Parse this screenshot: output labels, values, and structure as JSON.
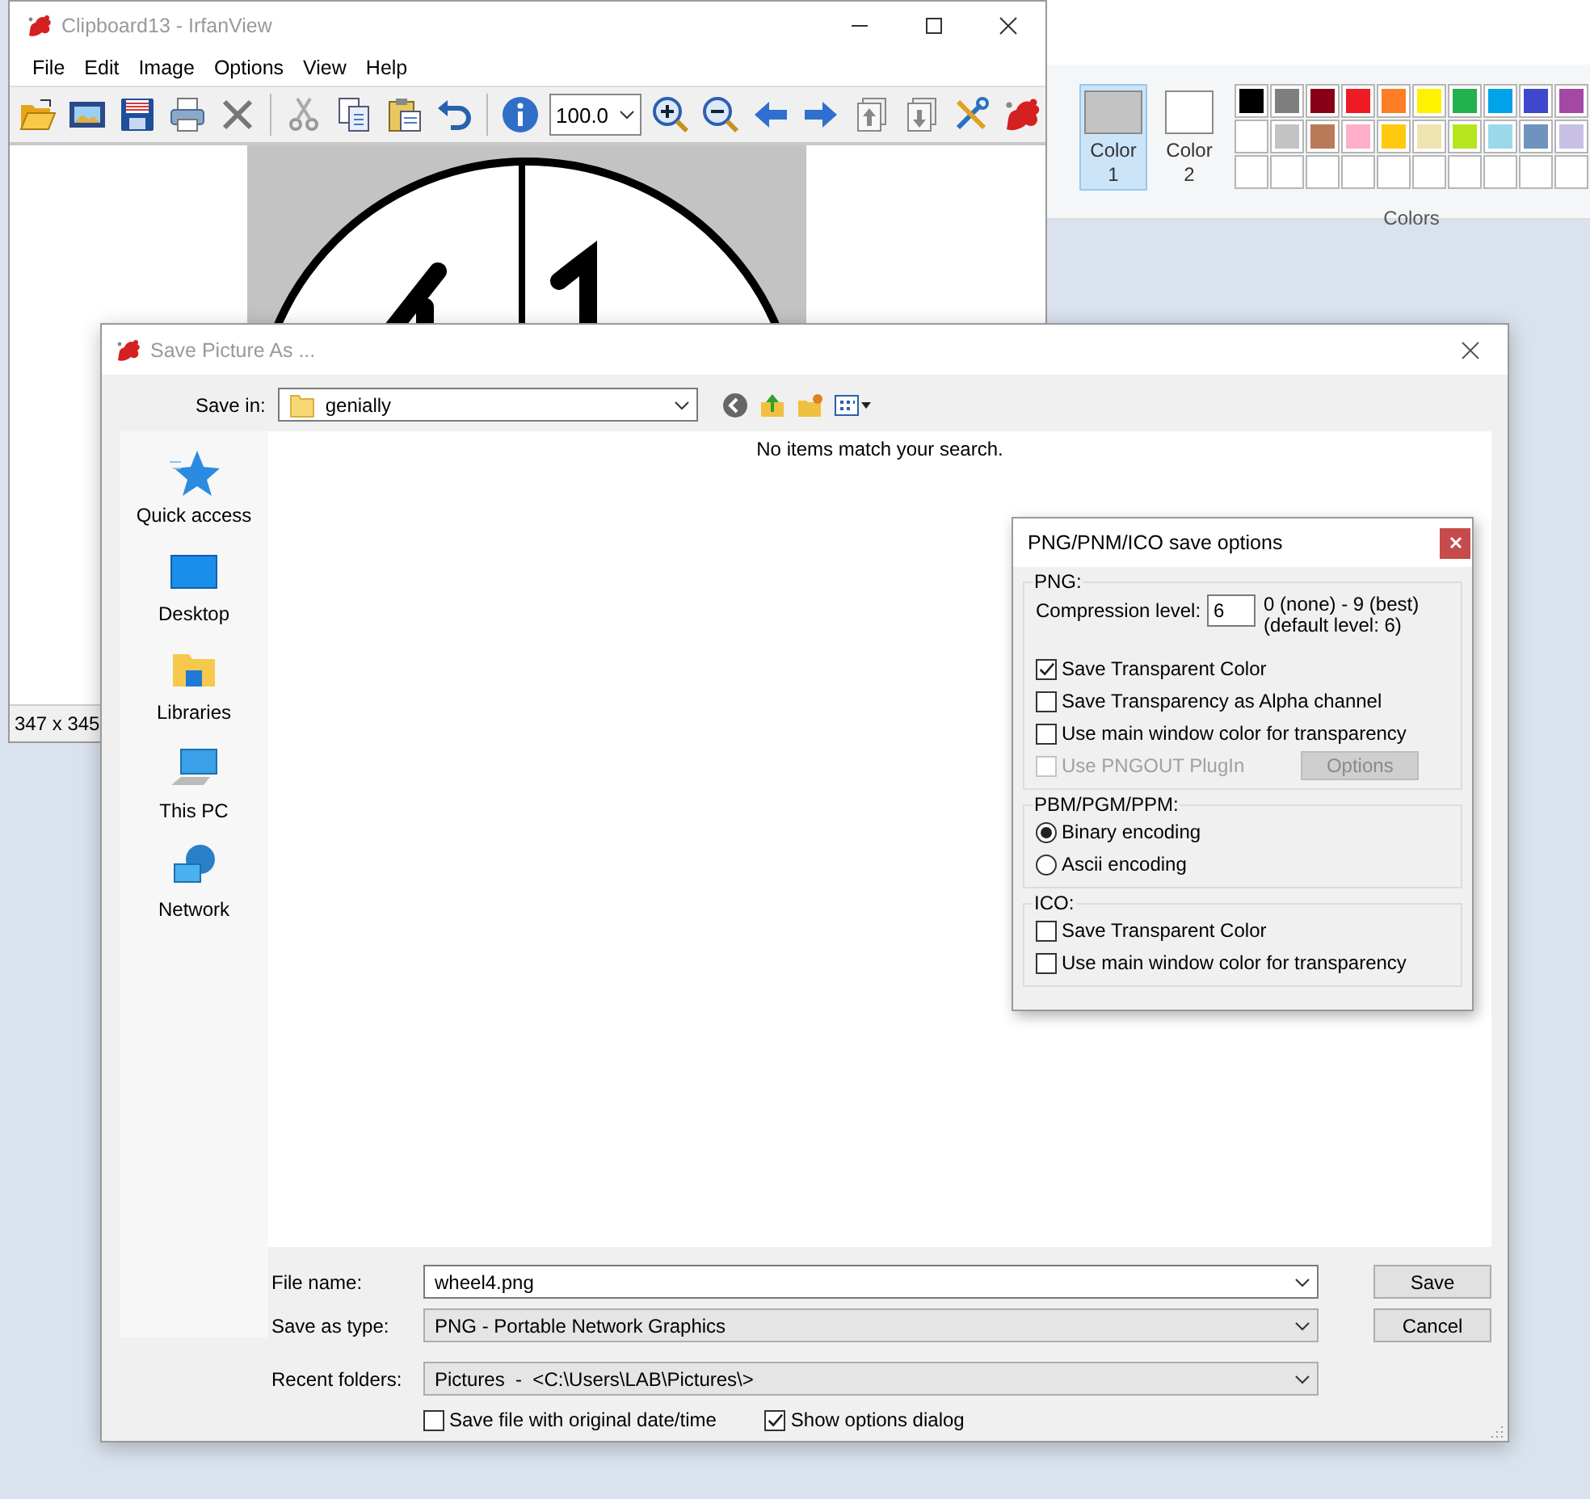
{
  "paint": {
    "color_buttons": [
      {
        "label": "Color 1",
        "color": "#c3c3c3",
        "selected": true
      },
      {
        "label": "Color 2",
        "color": "#ffffff",
        "selected": false
      }
    ],
    "palette": [
      {
        "kind": "swatch",
        "color": "#000000"
      },
      {
        "kind": "swatch",
        "color": "#7f7f7f"
      },
      {
        "kind": "swatch",
        "color": "#880015"
      },
      {
        "kind": "swatch",
        "color": "#ed1c24"
      },
      {
        "kind": "swatch",
        "color": "#ff7f27"
      },
      {
        "kind": "swatch",
        "color": "#fff200"
      },
      {
        "kind": "swatch",
        "color": "#22b14c"
      },
      {
        "kind": "swatch",
        "color": "#00a2e8"
      },
      {
        "kind": "swatch",
        "color": "#3f48cc"
      },
      {
        "kind": "swatch",
        "color": "#a349a4"
      },
      {
        "kind": "swatch",
        "color": "#ffffff"
      },
      {
        "kind": "swatch",
        "color": "#c3c3c3"
      },
      {
        "kind": "swatch",
        "color": "#b97a57"
      },
      {
        "kind": "swatch",
        "color": "#ffaec9"
      },
      {
        "kind": "swatch",
        "color": "#ffc90e"
      },
      {
        "kind": "swatch",
        "color": "#efe4b0"
      },
      {
        "kind": "swatch",
        "color": "#b5e61d"
      },
      {
        "kind": "swatch",
        "color": "#99d9ea"
      },
      {
        "kind": "swatch",
        "color": "#7092be"
      },
      {
        "kind": "swatch",
        "color": "#c8bfe7"
      },
      {
        "kind": "empty"
      },
      {
        "kind": "empty"
      },
      {
        "kind": "empty"
      },
      {
        "kind": "empty"
      },
      {
        "kind": "empty"
      },
      {
        "kind": "empty"
      },
      {
        "kind": "empty"
      },
      {
        "kind": "empty"
      },
      {
        "kind": "empty"
      },
      {
        "kind": "empty"
      }
    ],
    "group_label": "Colors"
  },
  "irfanview": {
    "title": "Clipboard13 - IrfanView",
    "menu": [
      "File",
      "Edit",
      "Image",
      "Options",
      "View",
      "Help"
    ],
    "zoom": "100.0",
    "status": "347 x 345"
  },
  "save_dialog": {
    "title": "Save Picture As ...",
    "save_in": {
      "label": "Save in:",
      "value": "genially"
    },
    "places": [
      {
        "label": "Quick access"
      },
      {
        "label": "Desktop"
      },
      {
        "label": "Libraries"
      },
      {
        "label": "This PC"
      },
      {
        "label": "Network"
      }
    ],
    "empty_message": "No items match your search.",
    "fields": [
      {
        "kind": "input",
        "label": "File name:",
        "value": "wheel4.png"
      },
      {
        "kind": "combo",
        "label": "Save as type:",
        "value": "PNG - Portable Network Graphics"
      },
      {
        "kind": "combo",
        "label": "Recent folders:",
        "value": "Pictures  -  <C:\\Users\\LAB\\Pictures\\>"
      }
    ],
    "options": [
      {
        "label": "Save file with original date/time",
        "checked": false
      },
      {
        "label": "Show options dialog",
        "checked": true
      }
    ],
    "buttons": [
      "Save",
      "Cancel"
    ]
  },
  "png_dialog": {
    "title": "PNG/PNM/ICO save options",
    "groups": [
      {
        "title": "PNG:",
        "items": [
          {
            "kind": "number",
            "label": "Compression level:",
            "value": "6",
            "hint": "0 (none) - 9 (best)",
            "hint_2": "(default level: 6)"
          },
          {
            "kind": "checkbox",
            "label": "Save Transparent Color",
            "checked": true,
            "disabled": false
          },
          {
            "kind": "checkbox",
            "label": "Save Transparency as Alpha channel",
            "checked": false,
            "disabled": false
          },
          {
            "kind": "checkbox",
            "label": "Use main window color for transparency",
            "checked": false,
            "disabled": false
          },
          {
            "kind": "checkbox",
            "label": "Use PNGOUT PlugIn",
            "checked": false,
            "disabled": true,
            "button": {
              "label": "Options",
              "disabled": true
            }
          }
        ]
      },
      {
        "title": "PBM/PGM/PPM:",
        "items": [
          {
            "kind": "radio",
            "label": "Binary encoding",
            "selected": true
          },
          {
            "kind": "radio",
            "label": "Ascii encoding",
            "selected": false
          }
        ]
      },
      {
        "title": "ICO:",
        "items": [
          {
            "kind": "checkbox",
            "label": "Save Transparent Color",
            "checked": false,
            "disabled": false
          },
          {
            "kind": "checkbox",
            "label": "Use main window color for transparency",
            "checked": false,
            "disabled": false
          }
        ]
      }
    ]
  }
}
